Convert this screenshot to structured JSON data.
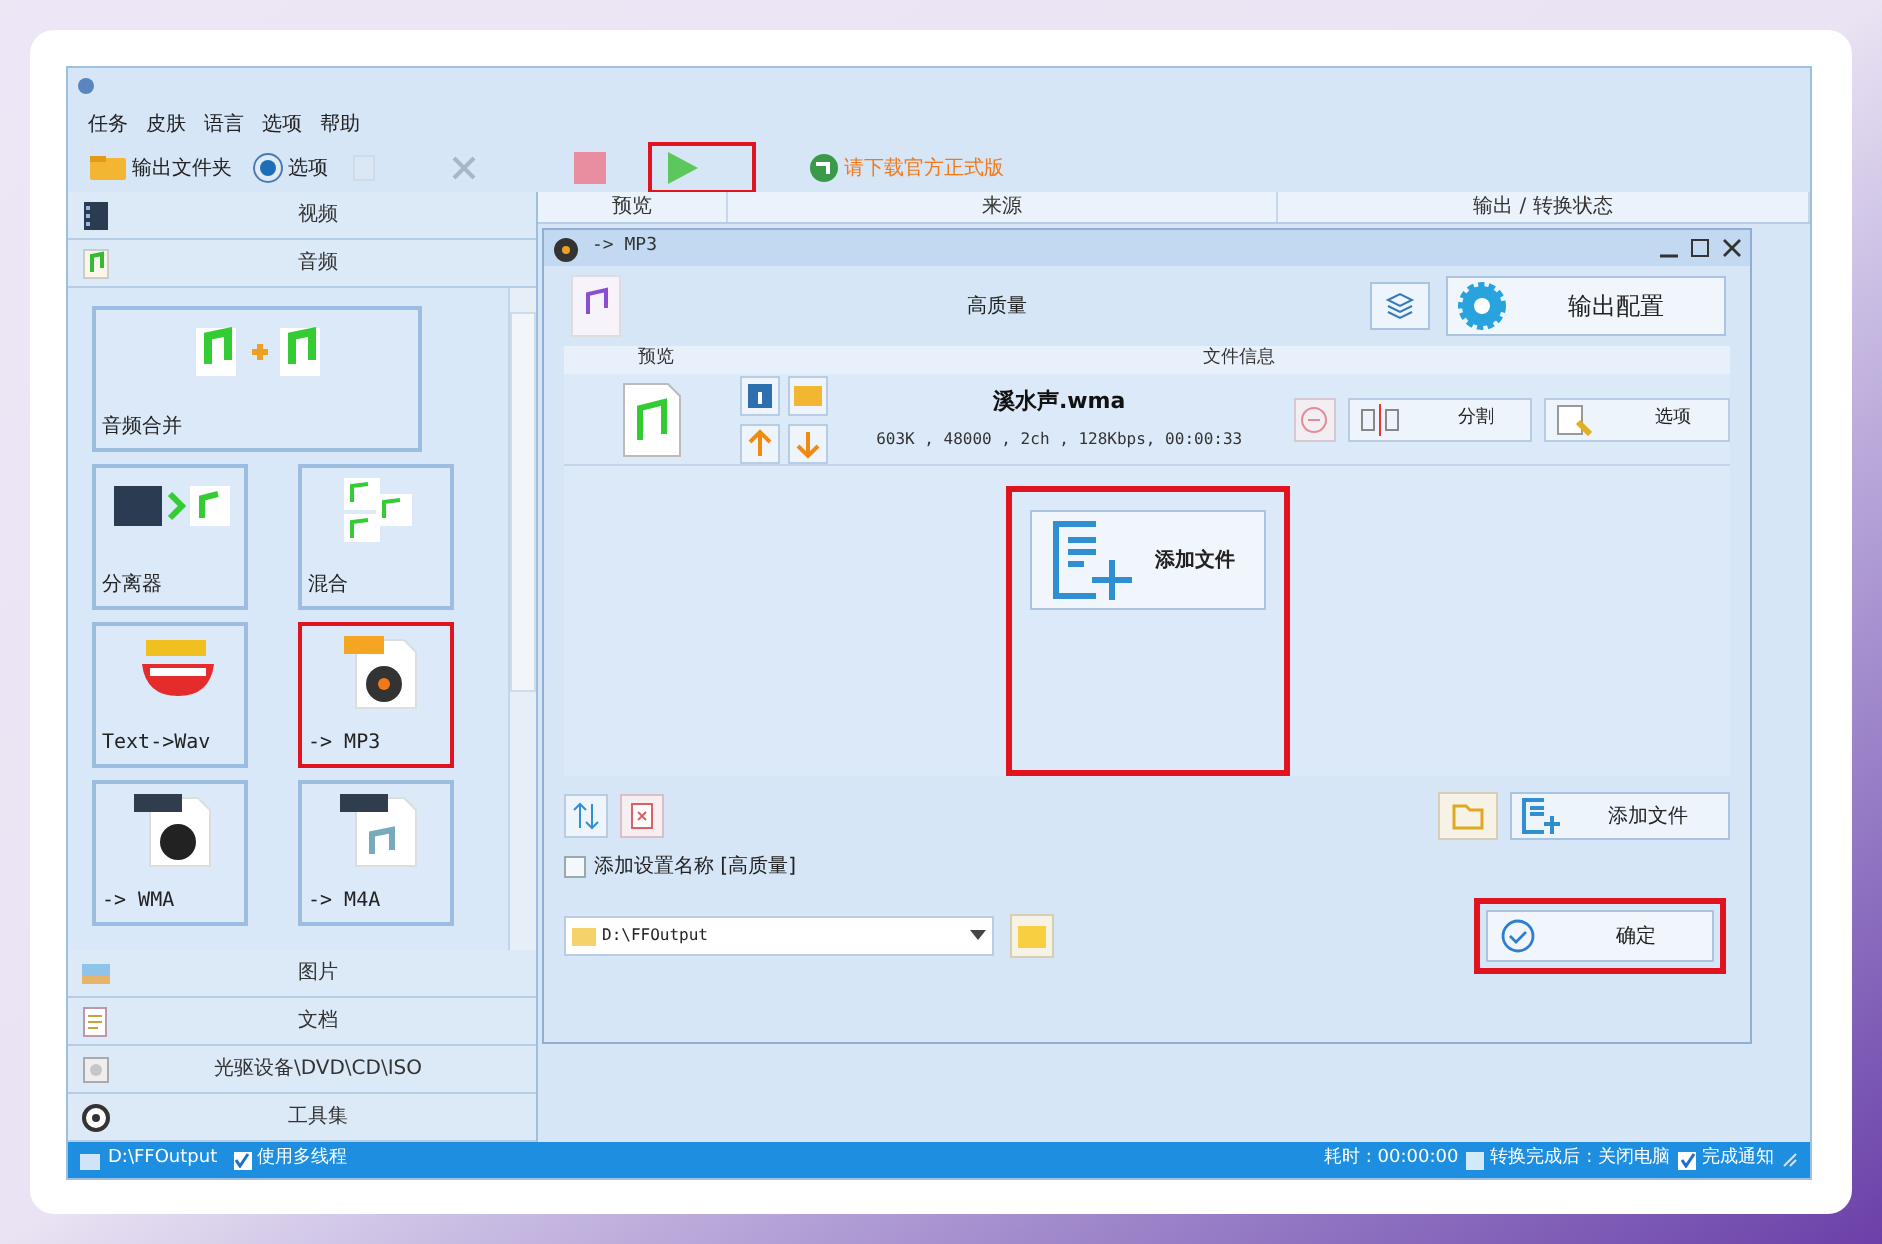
{
  "menu": [
    "任务",
    "皮肤",
    "语言",
    "选项",
    "帮助"
  ],
  "toolbar": [
    {
      "kind": "folder",
      "label": "输出文件夹",
      "highlighted": false
    },
    {
      "kind": "options",
      "label": "选项",
      "highlighted": false
    },
    {
      "kind": "clear",
      "highlighted": false
    },
    {
      "kind": "remove",
      "highlighted": false
    },
    {
      "kind": "stop",
      "highlighted": false
    },
    {
      "kind": "play",
      "highlighted": true
    },
    {
      "kind": "download",
      "label": "请下载官方正式版",
      "highlighted": false
    }
  ],
  "sidebar": {
    "top_categories": [
      {
        "kind": "video",
        "label": "视频"
      },
      {
        "kind": "audio",
        "label": "音频"
      }
    ],
    "tiles": [
      {
        "kind": "merge",
        "label": "音频合并",
        "wide": true,
        "highlighted": false
      },
      {
        "kind": "splitter",
        "label": "分离器",
        "wide": false,
        "highlighted": false
      },
      {
        "kind": "mix",
        "label": "混合",
        "wide": false,
        "highlighted": false
      },
      {
        "kind": "tts",
        "label": "Text->Wav",
        "wide": false,
        "highlighted": false
      },
      {
        "kind": "mp3",
        "label": "-> MP3",
        "wide": false,
        "highlighted": true
      },
      {
        "kind": "wma",
        "label": "-> WMA",
        "wide": false,
        "highlighted": false
      },
      {
        "kind": "m4a",
        "label": "-> M4A",
        "wide": false,
        "highlighted": false
      }
    ],
    "bottom_categories": [
      {
        "kind": "picture",
        "label": "图片"
      },
      {
        "kind": "document",
        "label": "文档"
      },
      {
        "kind": "disc",
        "label": "光驱设备\\DVD\\CD\\ISO"
      },
      {
        "kind": "tools",
        "label": "工具集"
      }
    ]
  },
  "task_list": {
    "columns": [
      "预览",
      "来源",
      "输出 / 转换状态"
    ]
  },
  "dialog": {
    "title": "-> MP3",
    "preset": "高质量",
    "config_button": "输出配置",
    "columns": [
      "预览",
      "文件信息"
    ],
    "files": [
      {
        "name": "溪水声.wma",
        "info": "603K , 48000 , 2ch , 128Kbps, 00:00:33"
      }
    ],
    "file_buttons": [
      "分割",
      "选项"
    ],
    "add_button": {
      "label": "添加文件",
      "highlighted": true
    },
    "add_file_button": "添加文件",
    "name_checkbox": {
      "label": "添加设置名称 [高质量]",
      "checked": false
    },
    "output_path": "D:\\FFOutput",
    "ok_button": {
      "label": "确定",
      "highlighted": true
    }
  },
  "status_bar": {
    "path": "D:\\FFOutput",
    "options": [
      {
        "label": "使用多线程",
        "checked": true
      }
    ],
    "elapsed": "耗时 : 00:00:00",
    "end_options": [
      {
        "label": "转换完成后 : 关闭电脑",
        "checked": false
      },
      {
        "label": "完成通知",
        "checked": true
      }
    ]
  }
}
